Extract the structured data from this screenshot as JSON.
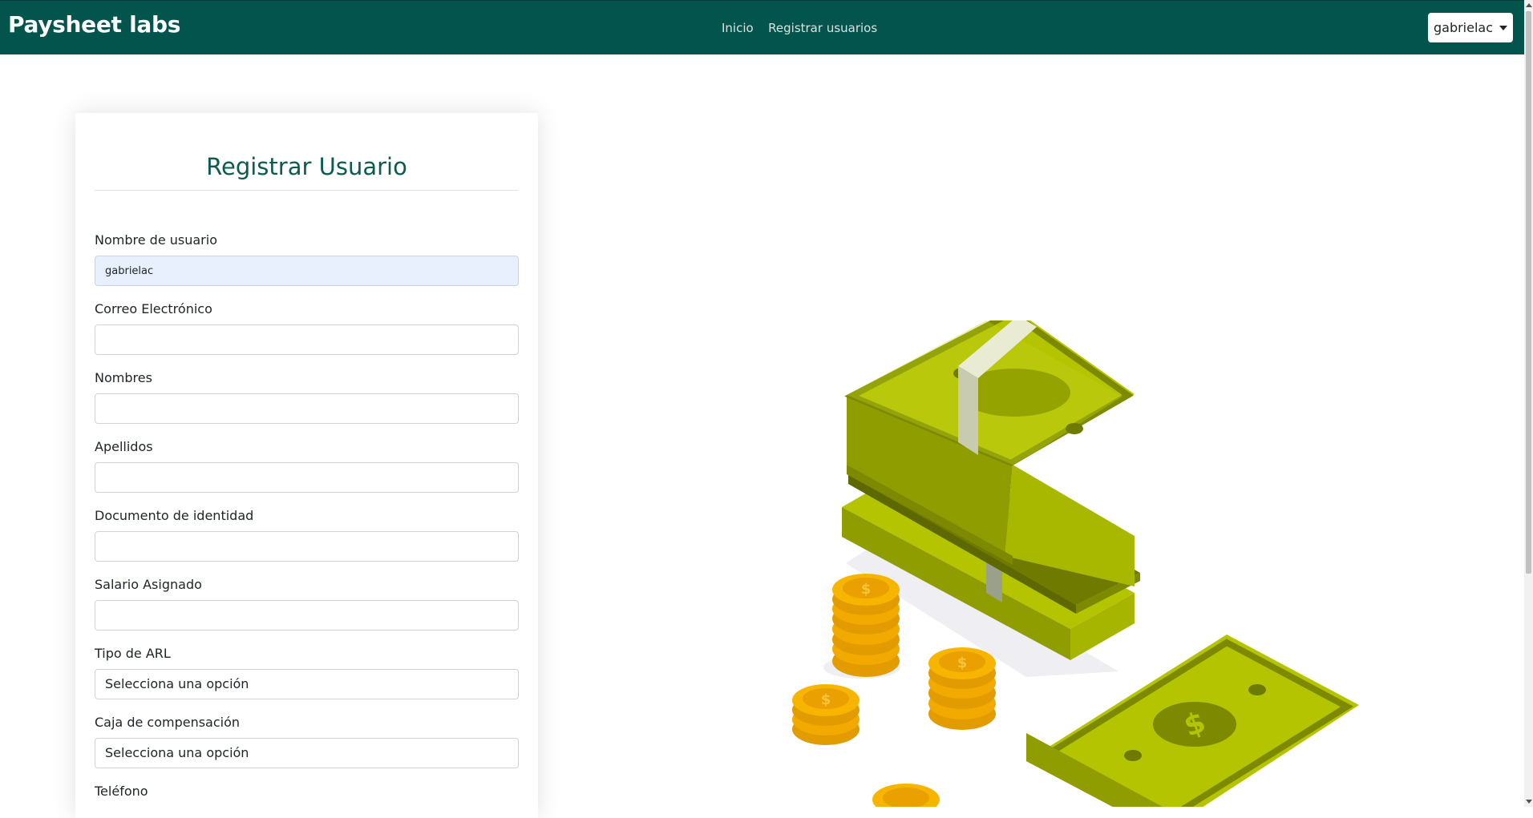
{
  "navbar": {
    "brand": "Paysheet labs",
    "links": [
      "Inicio",
      "Registrar usuarios"
    ],
    "user_menu": "gabrielac"
  },
  "form": {
    "title": "Registrar Usuario",
    "fields": [
      {
        "label": "Nombre de usuario",
        "value": "gabrielac"
      },
      {
        "label": "Correo Electrónico",
        "value": ""
      },
      {
        "label": "Nombres",
        "value": ""
      },
      {
        "label": "Apellidos",
        "value": ""
      },
      {
        "label": "Documento de identidad",
        "value": ""
      },
      {
        "label": "Salario Asignado",
        "value": ""
      },
      {
        "label": "Tipo de ARL",
        "value": "Selecciona una opción"
      },
      {
        "label": "Caja de compensación",
        "value": "Selecciona una opción"
      },
      {
        "label": "Teléfono",
        "value": ""
      }
    ]
  },
  "illustration": {
    "icon": "money-stack-and-coins-illustration",
    "colors": {
      "bill": "#b4c400",
      "bill_dark": "#7d8a00",
      "band": "#e9ebd2",
      "coin": "#f7b500"
    }
  },
  "colors": {
    "navbar": "#02544d",
    "title": "#0d5b4f",
    "autofill": "#e8f0fe"
  }
}
